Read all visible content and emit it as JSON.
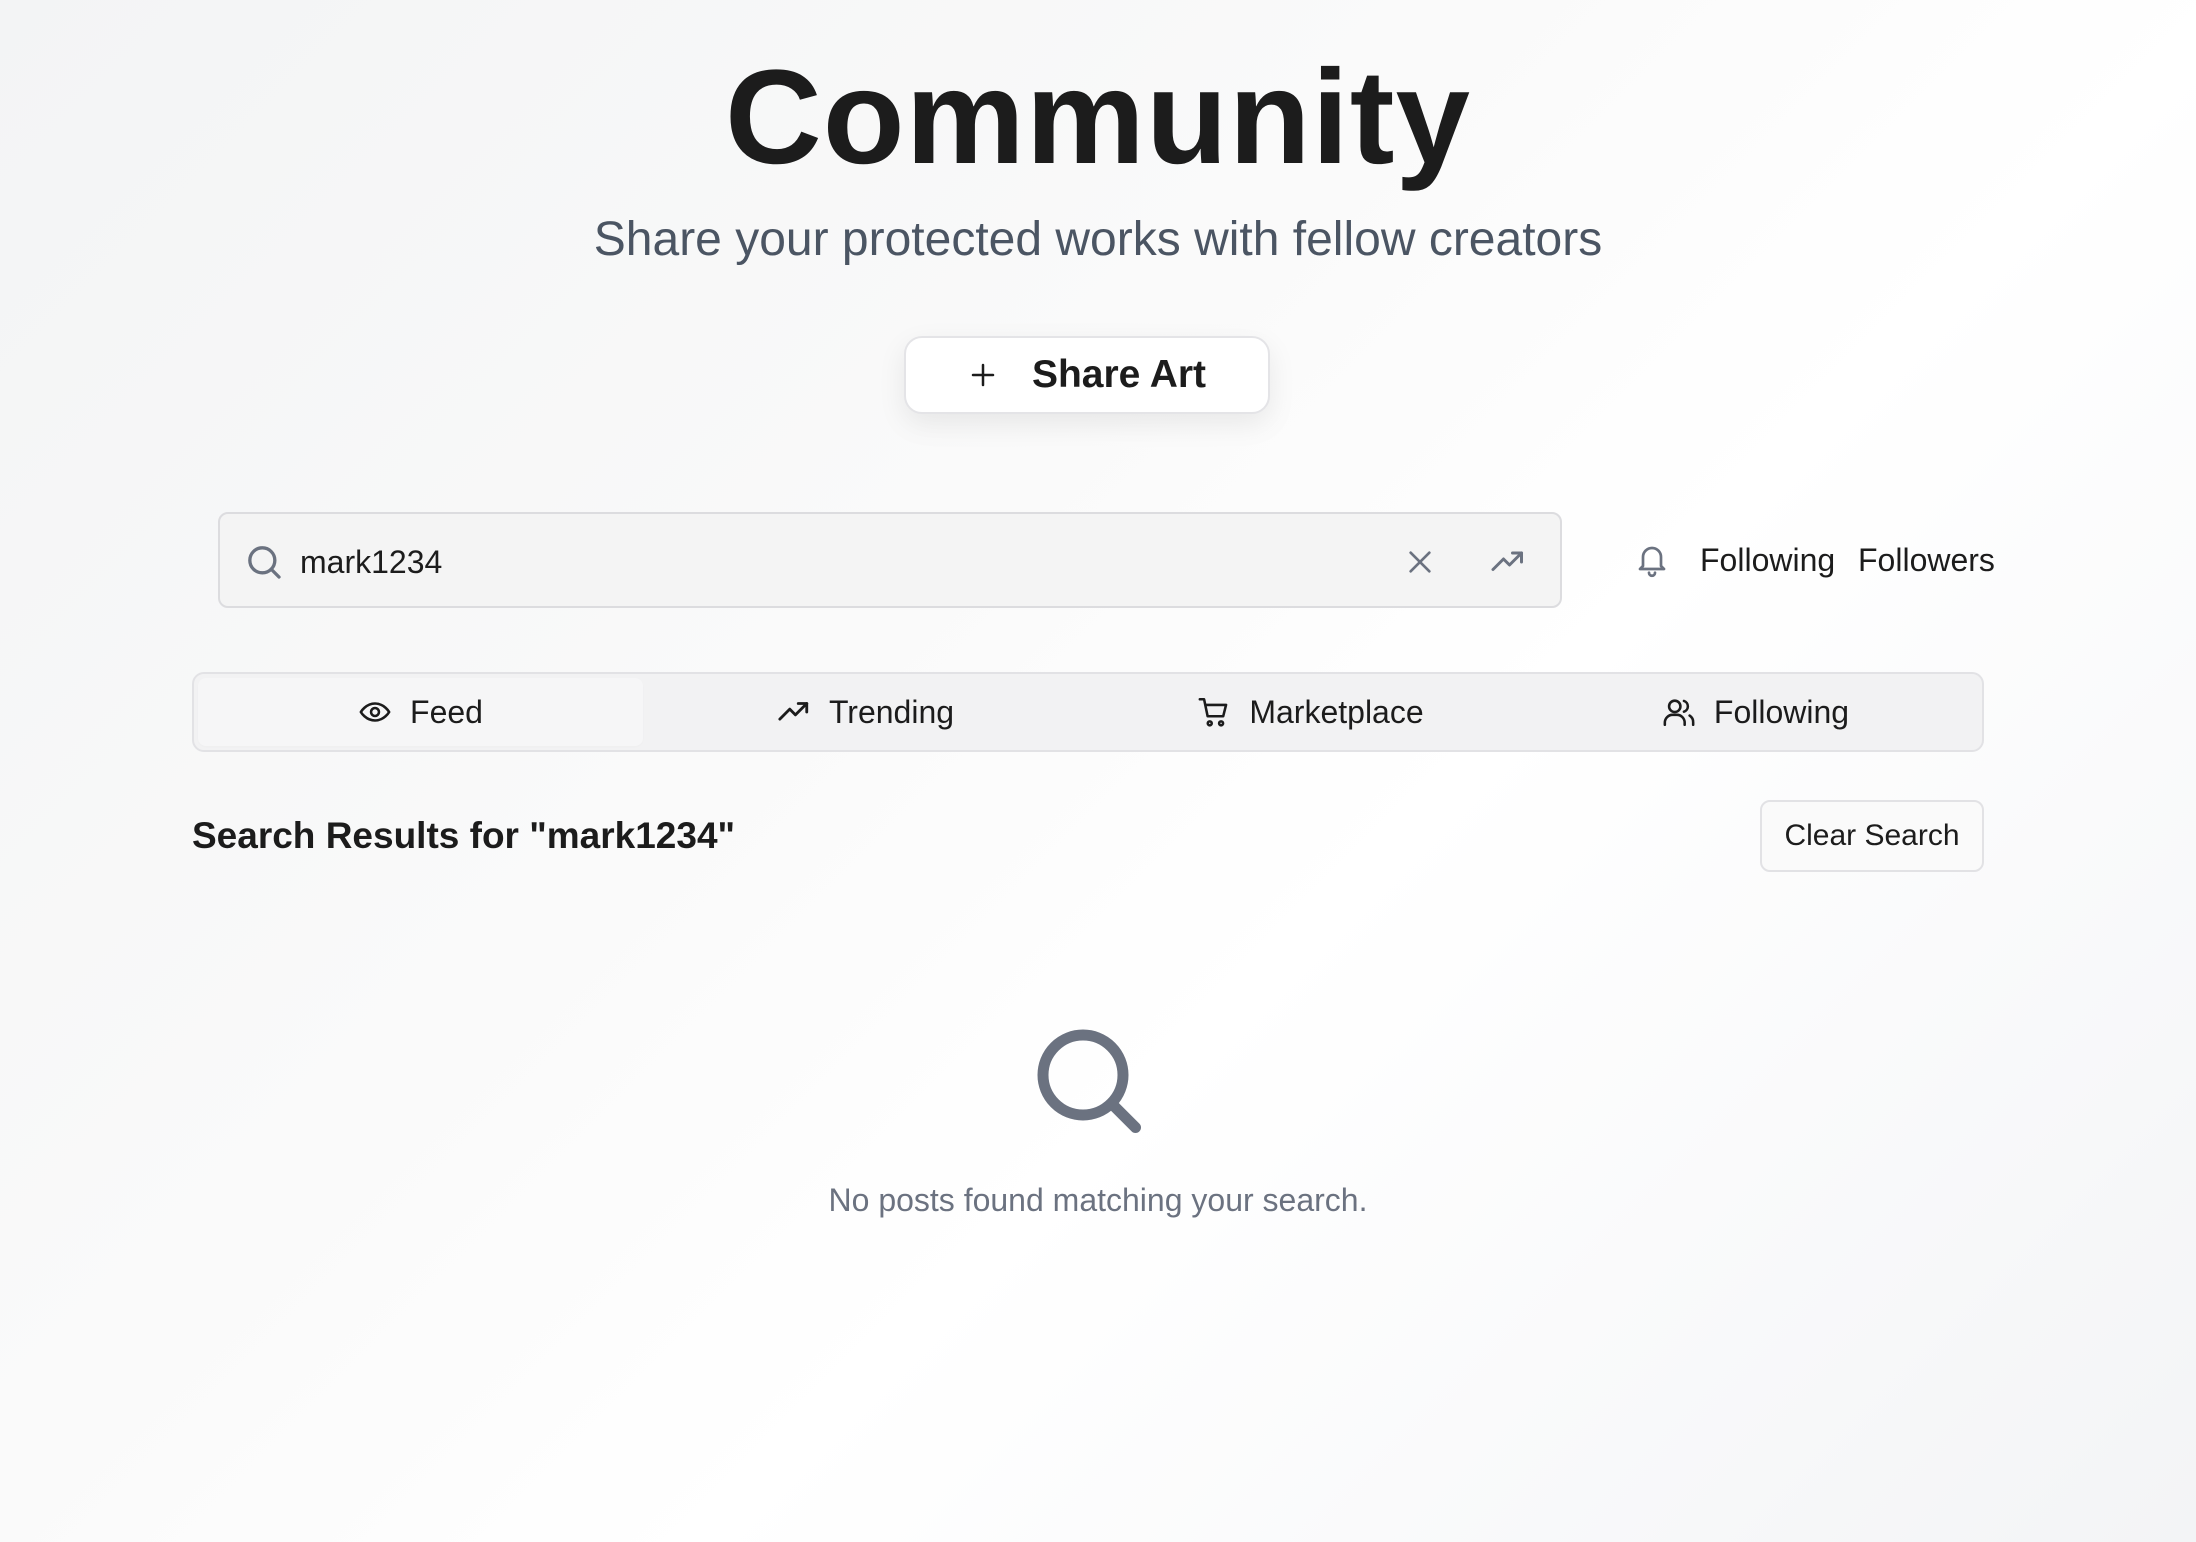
{
  "header": {
    "title": "Community",
    "subtitle": "Share your protected works with fellow creators",
    "share_button_label": "Share Art"
  },
  "search": {
    "value": "mark1234",
    "placeholder": ""
  },
  "top_links": {
    "following": "Following",
    "followers": "Followers"
  },
  "tabs": [
    {
      "label": "Feed",
      "icon": "eye-icon",
      "active": true
    },
    {
      "label": "Trending",
      "icon": "trending-up-icon",
      "active": false
    },
    {
      "label": "Marketplace",
      "icon": "shopping-cart-icon",
      "active": false
    },
    {
      "label": "Following",
      "icon": "users-icon",
      "active": false
    }
  ],
  "results": {
    "heading": "Search Results for \"mark1234\"",
    "clear_button_label": "Clear Search",
    "empty_message": "No posts found matching your search."
  },
  "colors": {
    "text_primary": "#1c1c1c",
    "text_secondary": "#4b5563",
    "text_muted": "#6b7280",
    "icon_gray": "#6b7280"
  }
}
